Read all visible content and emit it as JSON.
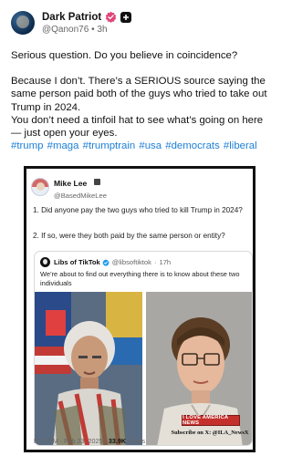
{
  "post": {
    "display_name": "Dark Patriot",
    "handle": "@Qanon76",
    "separator": "•",
    "time_ago": "3h",
    "line1": "Serious question. Do you believe in coincidence?",
    "line2": "Because I don’t. There’s a SERIOUS source saying the same person paid both of the guys who tried to take out Trump in 2024.",
    "line3": "You don’t need a tinfoil hat to see what’s going on here — just open your eyes.",
    "hashtags": "#trump #maga #trumptrain #usa #democrats #liberal"
  },
  "embedded_tweet": {
    "name": "Mike Lee",
    "handle": "@BasedMikeLee",
    "question1": "1. Did anyone pay the two guys who tried to kill Trump in 2024?",
    "question2": "2. If so, were they both paid by the same person or entity?",
    "quote": {
      "name": "Libs of TikTok",
      "handle": "@libsoftiktok",
      "separator": "·",
      "time_ago": "17h",
      "text": "We’re about to find out everything there is to know about these two individuals"
    },
    "timestamp_prefix": "8:50 PM · Feb 23, 2025 ·",
    "views": "33.9K",
    "views_label": "Views"
  },
  "watermark": {
    "badge": "I LOVE AMERICA NEWS",
    "subscribe": "Subscribe on X: @ILA_NewsX"
  },
  "colors": {
    "link_blue": "#1d7fd6",
    "verified_badge": "#e0457b",
    "watermark_red": "#c4302b"
  }
}
